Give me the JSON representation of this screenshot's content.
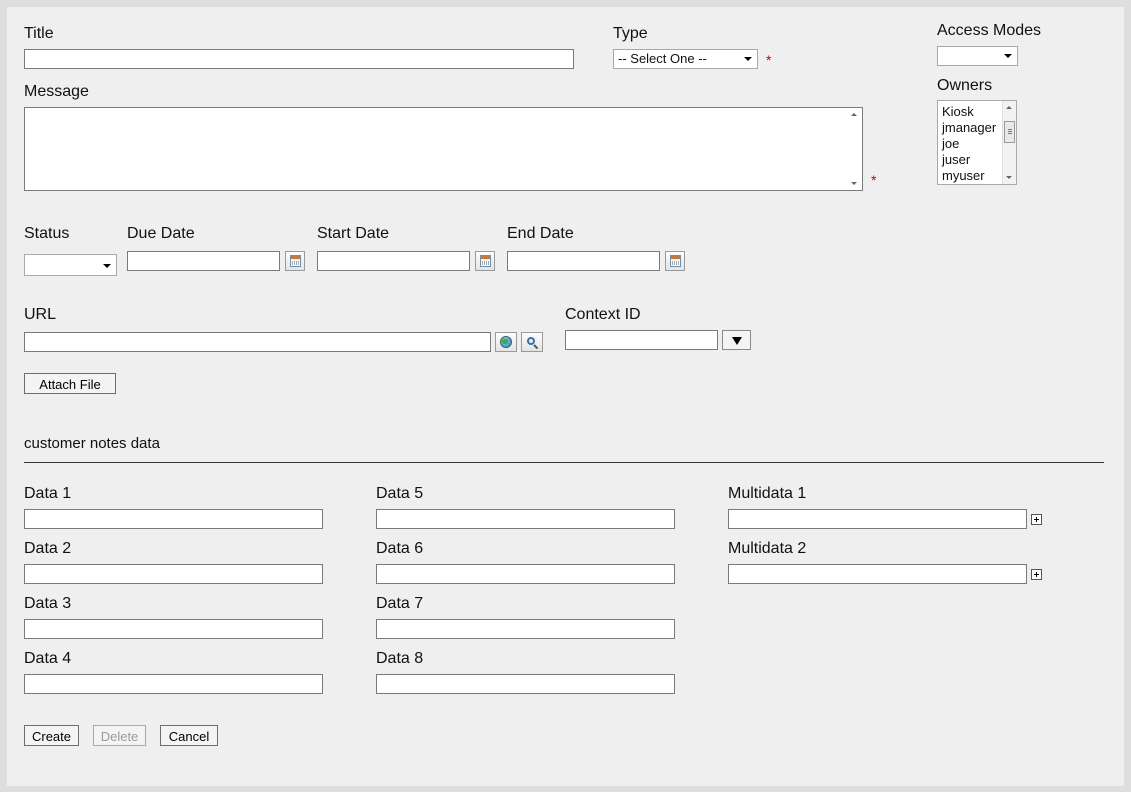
{
  "form": {
    "title_label": "Title",
    "type_label": "Type",
    "type_selected": "-- Select One --",
    "required_mark": "*",
    "access_modes_label": "Access Modes",
    "access_modes_selected": "",
    "owners_label": "Owners",
    "owners": [
      "Kiosk",
      "jmanager",
      "joe",
      "juser",
      "myuser"
    ],
    "message_label": "Message",
    "status_label": "Status",
    "status_selected": "",
    "due_date_label": "Due Date",
    "start_date_label": "Start Date",
    "end_date_label": "End Date",
    "url_label": "URL",
    "context_id_label": "Context ID",
    "attach_file_label": "Attach File"
  },
  "section": {
    "title": "customer notes data"
  },
  "data_fields": {
    "data1": "Data 1",
    "data2": "Data 2",
    "data3": "Data 3",
    "data4": "Data 4",
    "data5": "Data 5",
    "data6": "Data 6",
    "data7": "Data 7",
    "data8": "Data 8",
    "multidata1": "Multidata 1",
    "multidata2": "Multidata 2"
  },
  "actions": {
    "create": "Create",
    "delete": "Delete",
    "cancel": "Cancel"
  },
  "icons": {
    "calendar": "calendar-icon",
    "globe": "globe-icon",
    "search": "magnifier-icon",
    "add": "plus-icon"
  }
}
